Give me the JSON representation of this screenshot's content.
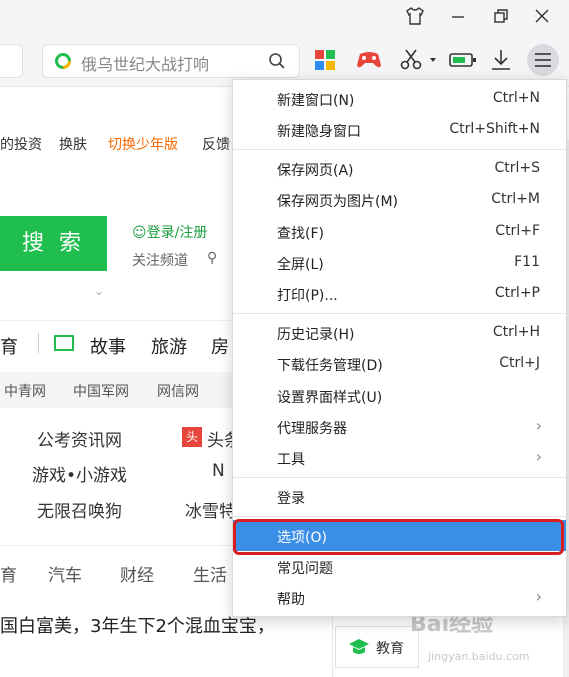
{
  "toolbar": {
    "search_placeholder": "俄乌世纪大战打响"
  },
  "nav_links": [
    "的投资",
    "换肤",
    "切换少年版",
    "反馈"
  ],
  "accent_color": "#ff6a00",
  "search_button": "搜 索",
  "login_link": "登录/注册",
  "follow_text": "关注频道",
  "categories": [
    "育",
    "故事",
    "旅游",
    "房"
  ],
  "sites": [
    "中青网",
    "中国军网",
    "网信网"
  ],
  "links": {
    "row1": [
      "公考资讯网",
      "头条"
    ],
    "row2": [
      "游戏•小游戏",
      "N"
    ],
    "row3": [
      "无限召唤狗",
      "冰雪特"
    ]
  },
  "tabs2": [
    "育",
    "汽车",
    "财经",
    "生活"
  ],
  "headline": "国白富美，3年生下2个混血宝宝，",
  "edu_button": "教育",
  "watermark": "Bai经验",
  "watermark_sub": "jingyan.baidu.com",
  "menu": {
    "items": [
      {
        "label": "新建窗口(N)",
        "shortcut": "Ctrl+N"
      },
      {
        "label": "新建隐身窗口",
        "shortcut": "Ctrl+Shift+N"
      },
      {
        "label": "保存网页(A)",
        "shortcut": "Ctrl+S"
      },
      {
        "label": "保存网页为图片(M)",
        "shortcut": "Ctrl+M"
      },
      {
        "label": "查找(F)",
        "shortcut": "Ctrl+F"
      },
      {
        "label": "全屏(L)",
        "shortcut": "F11"
      },
      {
        "label": "打印(P)...",
        "shortcut": "Ctrl+P"
      },
      {
        "label": "历史记录(H)",
        "shortcut": "Ctrl+H"
      },
      {
        "label": "下载任务管理(D)",
        "shortcut": "Ctrl+J"
      },
      {
        "label": "设置界面样式(U)",
        "shortcut": ""
      },
      {
        "label": "代理服务器",
        "shortcut": ""
      },
      {
        "label": "工具",
        "shortcut": ""
      },
      {
        "label": "登录",
        "shortcut": ""
      },
      {
        "label": "选项(O)",
        "shortcut": ""
      },
      {
        "label": "常见问题",
        "shortcut": ""
      },
      {
        "label": "帮助",
        "shortcut": ""
      }
    ]
  },
  "highlight_color": "#3a8ee6",
  "annotation_color": "#d81e1e"
}
